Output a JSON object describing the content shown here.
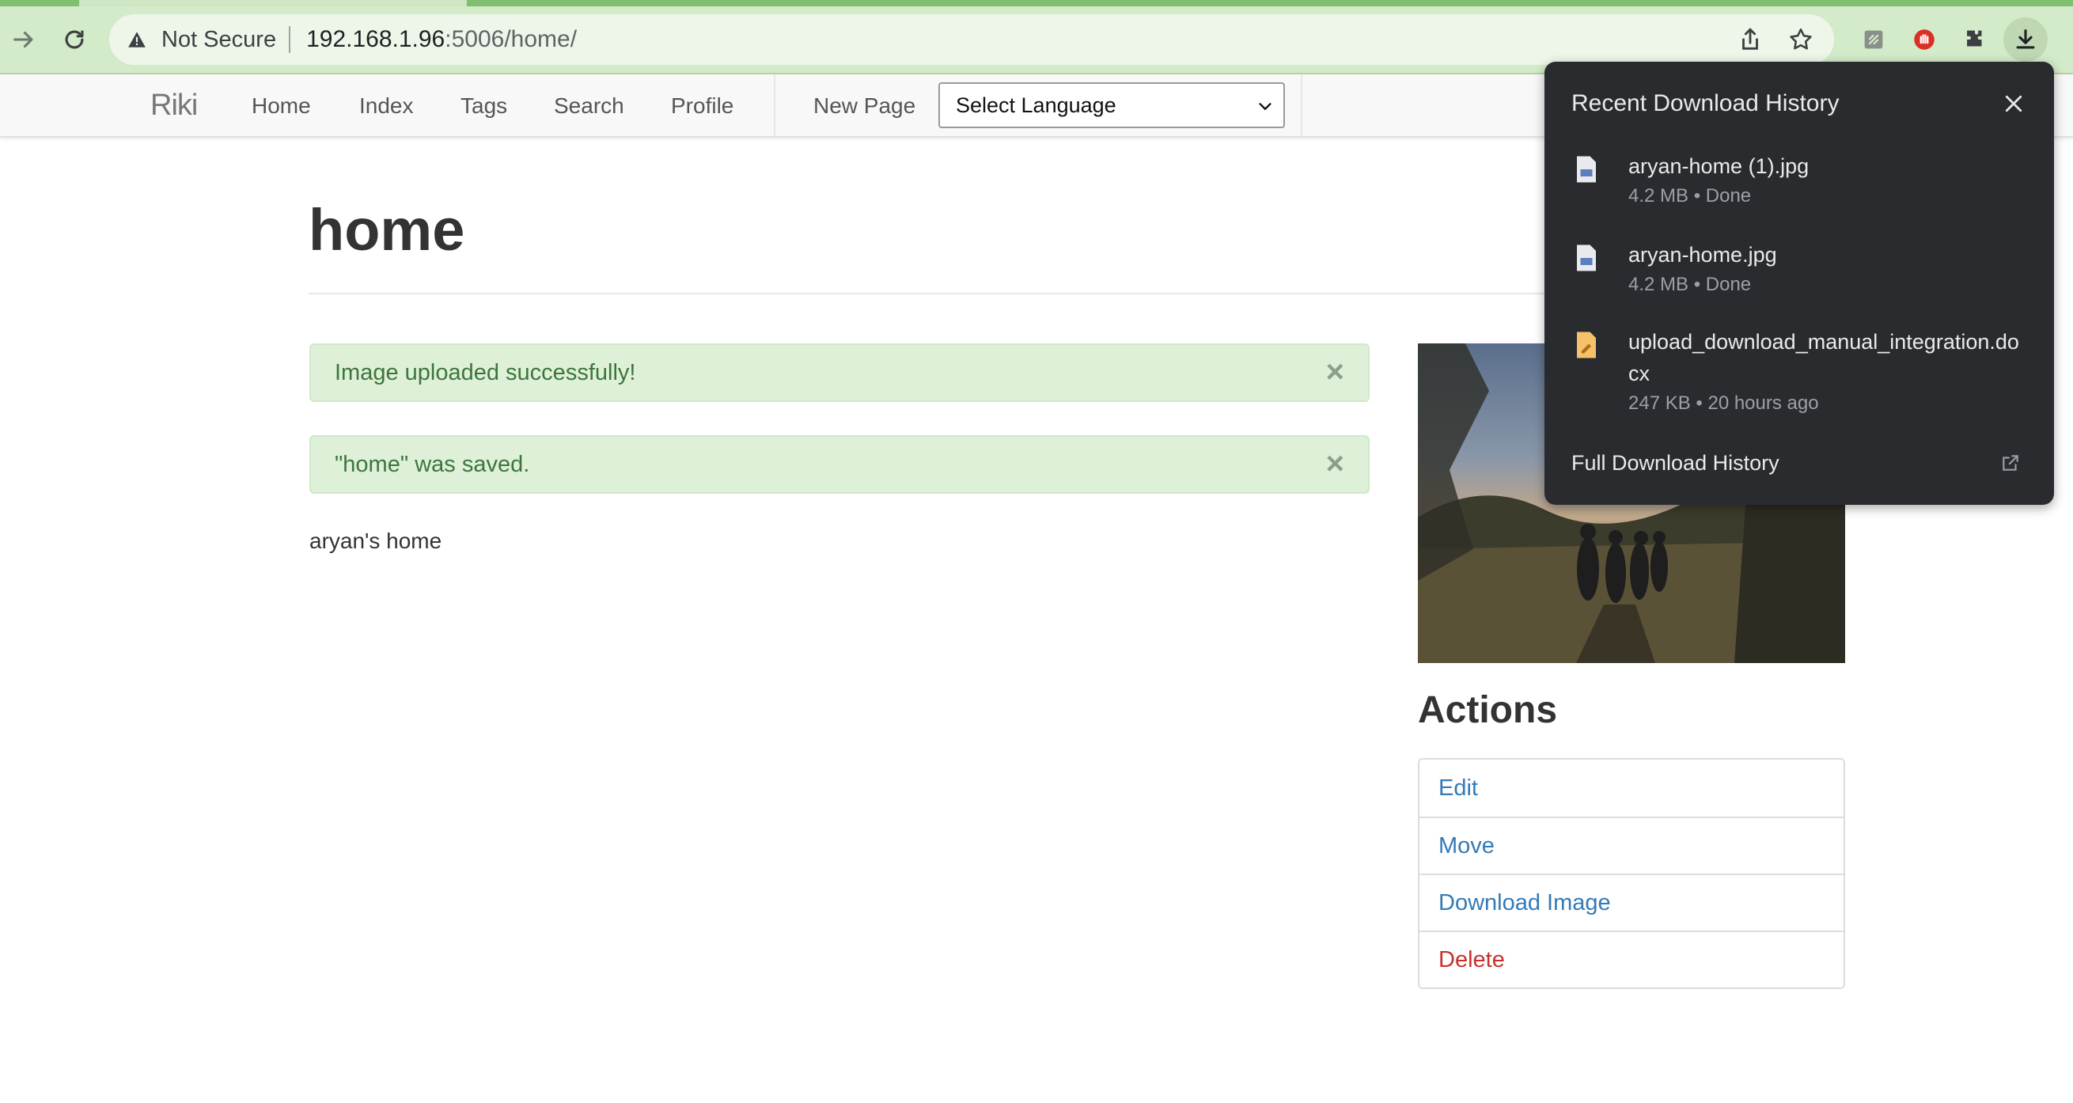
{
  "browser": {
    "security_label": "Not Secure",
    "url_host": "192.168.1.96",
    "url_rest": ":5006/home/"
  },
  "nav": {
    "brand": "Riki",
    "links": [
      "Home",
      "Index",
      "Tags",
      "Search",
      "Profile"
    ],
    "new_page": "New Page",
    "language_select": "Select Language"
  },
  "page": {
    "title": "home",
    "alerts": [
      {
        "text": "Image uploaded successfully!",
        "close": "×"
      },
      {
        "text": "\"home\" was saved.",
        "close": "×"
      }
    ],
    "body_text": "aryan's home"
  },
  "sidebar": {
    "actions_title": "Actions",
    "actions": [
      "Edit",
      "Move",
      "Download Image",
      "Delete"
    ]
  },
  "downloads": {
    "title": "Recent Download History",
    "items": [
      {
        "name": "aryan-home (1).jpg",
        "meta": "4.2 MB • Done",
        "icon": "image-file-icon"
      },
      {
        "name": "aryan-home.jpg",
        "meta": "4.2 MB • Done",
        "icon": "image-file-icon"
      },
      {
        "name": "upload_download_manual_integration.docx",
        "meta": "247 KB • 20 hours ago",
        "icon": "document-file-icon"
      }
    ],
    "full_history": "Full Download History"
  },
  "colors": {
    "chrome_green": "#d3ebc9",
    "alert_bg": "#dff0d8",
    "alert_text": "#3c763d",
    "link_blue": "#337ab7",
    "danger_red": "#c9302c",
    "bubble_bg": "#2a2b2e"
  }
}
